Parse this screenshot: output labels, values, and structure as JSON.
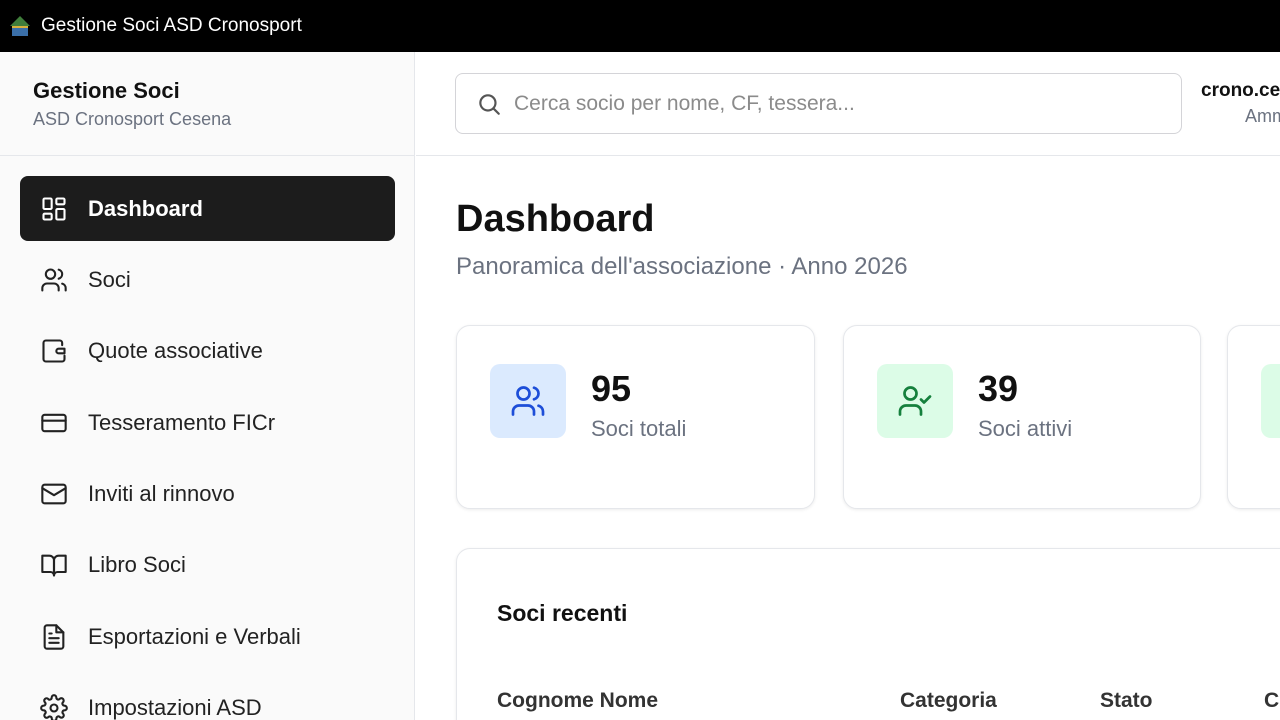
{
  "window": {
    "title": "Gestione Soci ASD Cronosport"
  },
  "brand": {
    "title": "Gestione Soci",
    "subtitle": "ASD Cronosport Cesena"
  },
  "sidebar": {
    "items": [
      {
        "label": "Dashboard",
        "icon": "dashboard-grid-icon",
        "active": true
      },
      {
        "label": "Soci",
        "icon": "users-icon"
      },
      {
        "label": "Quote associative",
        "icon": "wallet-icon"
      },
      {
        "label": "Tesseramento FICr",
        "icon": "credit-card-icon"
      },
      {
        "label": "Inviti al rinnovo",
        "icon": "mail-icon"
      },
      {
        "label": "Libro Soci",
        "icon": "book-open-icon"
      },
      {
        "label": "Esportazioni e Verbali",
        "icon": "file-text-icon"
      },
      {
        "label": "Impostazioni ASD",
        "icon": "gear-icon"
      }
    ]
  },
  "search": {
    "placeholder": "Cerca socio per nome, CF, tessera..."
  },
  "user": {
    "name": "crono.ces",
    "role": "Amm"
  },
  "page": {
    "title": "Dashboard",
    "subtitle": "Panoramica dell'associazione · Anno 2026"
  },
  "stats": [
    {
      "value": "95",
      "label": "Soci totali",
      "icon": "users-icon",
      "icon_bg": "#dbeafe",
      "icon_color": "#1d4ed8"
    },
    {
      "value": "39",
      "label": "Soci attivi",
      "icon": "user-check-icon",
      "icon_bg": "#dcfce7",
      "icon_color": "#15803d"
    },
    {
      "value": "",
      "label": "",
      "icon": "",
      "icon_bg": "#dcfce7",
      "icon_color": "#15803d"
    }
  ],
  "recent": {
    "title": "Soci recenti",
    "columns": [
      "Cognome Nome",
      "Categoria",
      "Stato",
      "C"
    ]
  }
}
